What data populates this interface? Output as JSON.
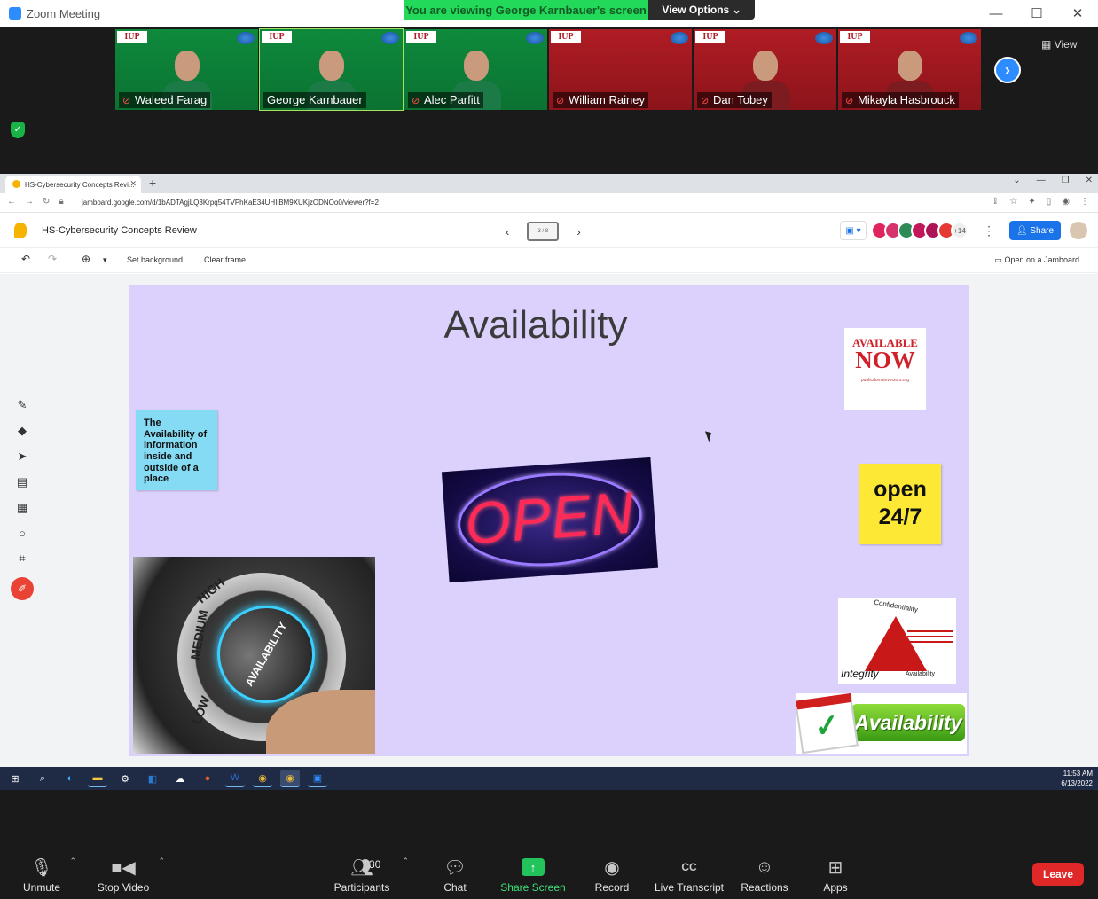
{
  "zoom": {
    "window_title": "Zoom Meeting",
    "viewing_banner": "You are viewing George Karnbauer's screen",
    "view_options": "View Options",
    "view_button": "View",
    "window_controls": {
      "minimize": "—",
      "maximize": "☐",
      "close": "✕"
    },
    "participants_strip": [
      {
        "name": "Waleed Farag",
        "muted": true,
        "bg": "green"
      },
      {
        "name": "George Karnbauer",
        "muted": false,
        "bg": "green",
        "active": true
      },
      {
        "name": "Alec Parfitt",
        "muted": true,
        "bg": "green"
      },
      {
        "name": "William Rainey",
        "muted": true,
        "bg": "red"
      },
      {
        "name": "Dan Tobey",
        "muted": true,
        "bg": "red"
      },
      {
        "name": "Mikayla Hasbrouck",
        "muted": true,
        "bg": "red"
      }
    ],
    "logo_text": "IUP",
    "toolbar": {
      "unmute": "Unmute",
      "stop_video": "Stop Video",
      "participants": "Participants",
      "participants_count": "30",
      "chat": "Chat",
      "share_screen": "Share Screen",
      "record": "Record",
      "live_transcript": "Live Transcript",
      "reactions": "Reactions",
      "apps": "Apps",
      "leave": "Leave"
    }
  },
  "chrome": {
    "tab_title": "HS-Cybersecurity Concepts Revi...",
    "url": "jamboard.google.com/d/1bADTAgjLQ3Krpq54TVPhKaE34UHIiBM9XUKjzODNOo0/viewer?f=2"
  },
  "jamboard": {
    "doc_title": "HS-Cybersecurity Concepts Review",
    "frame_indicator": "3 / 8",
    "avatar_more": "+14",
    "share": "Share",
    "set_background": "Set background",
    "clear_frame": "Clear frame",
    "open_on_jamboard": "Open on a Jamboard",
    "board": {
      "title": "Availability",
      "sticky_blue": "The Availability of information inside and outside of a place",
      "sticky_yellow_line1": "open",
      "sticky_yellow_line2": "24/7",
      "available_now_line1": "AVAILABLE",
      "available_now_line2": "NOW",
      "available_now_url": "publicdomainvectors.org",
      "open_sign": "OPEN",
      "knob_labels": {
        "low": "LOW",
        "medium": "MEDIUM",
        "high": "HIGH",
        "center": "AVAILABILITY"
      },
      "cia_confidentiality": "Confidentiality",
      "cia_integrity": "Integrity",
      "cia_availability": "Availability",
      "calendar_badge": "Availability"
    }
  },
  "taskbar": {
    "time": "11:53 AM",
    "date": "6/13/2022"
  }
}
